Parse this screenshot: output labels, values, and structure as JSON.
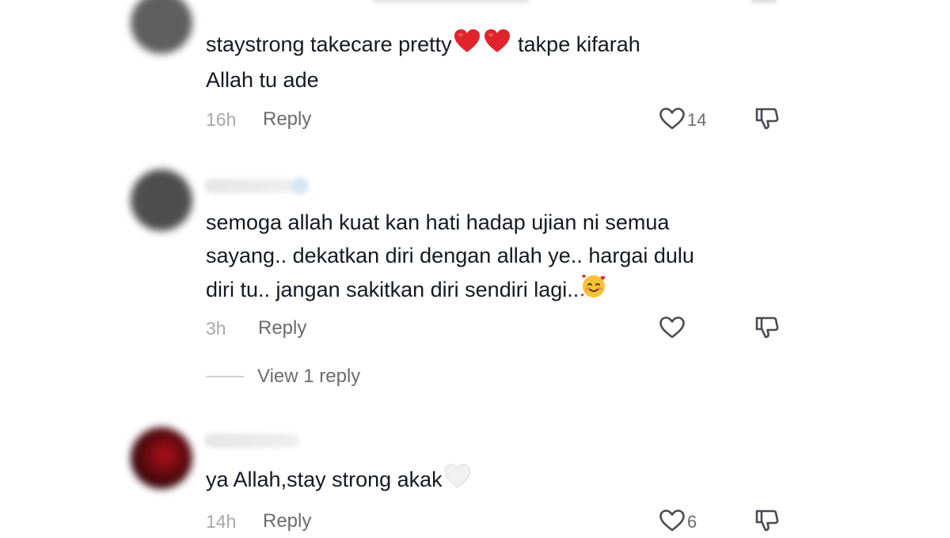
{
  "comments": [
    {
      "text_before_emoji": "staystrong takecare pretty",
      "text_after_emoji": " takpe kifarah",
      "text_line2": "Allah tu ade",
      "time": "16h",
      "reply_label": "Reply",
      "like_count": "14"
    },
    {
      "text_line1": "semoga allah kuat kan hati hadap ujian ni semua",
      "text_line2": "sayang.. dekatkan diri dengan allah ye.. hargai dulu",
      "text_line3": "diri tu.. jangan sakitkan diri sendiri lagi..",
      "time": "3h",
      "reply_label": "Reply",
      "view_replies_label": "View 1 reply"
    },
    {
      "text": "ya Allah,stay strong akak",
      "time": "14h",
      "reply_label": "Reply",
      "like_count": "6"
    }
  ],
  "icons": {
    "like": "heart-outline-icon",
    "dislike": "thumbs-down-icon",
    "red_heart": "red-heart-emoji",
    "smiling_hearts": "smiling-face-with-hearts-emoji",
    "white_heart": "white-heart-emoji"
  },
  "colors": {
    "text": "#161823",
    "muted": "#6b6b73",
    "time": "#a7a7ad",
    "heart_red": "#e0242b"
  }
}
